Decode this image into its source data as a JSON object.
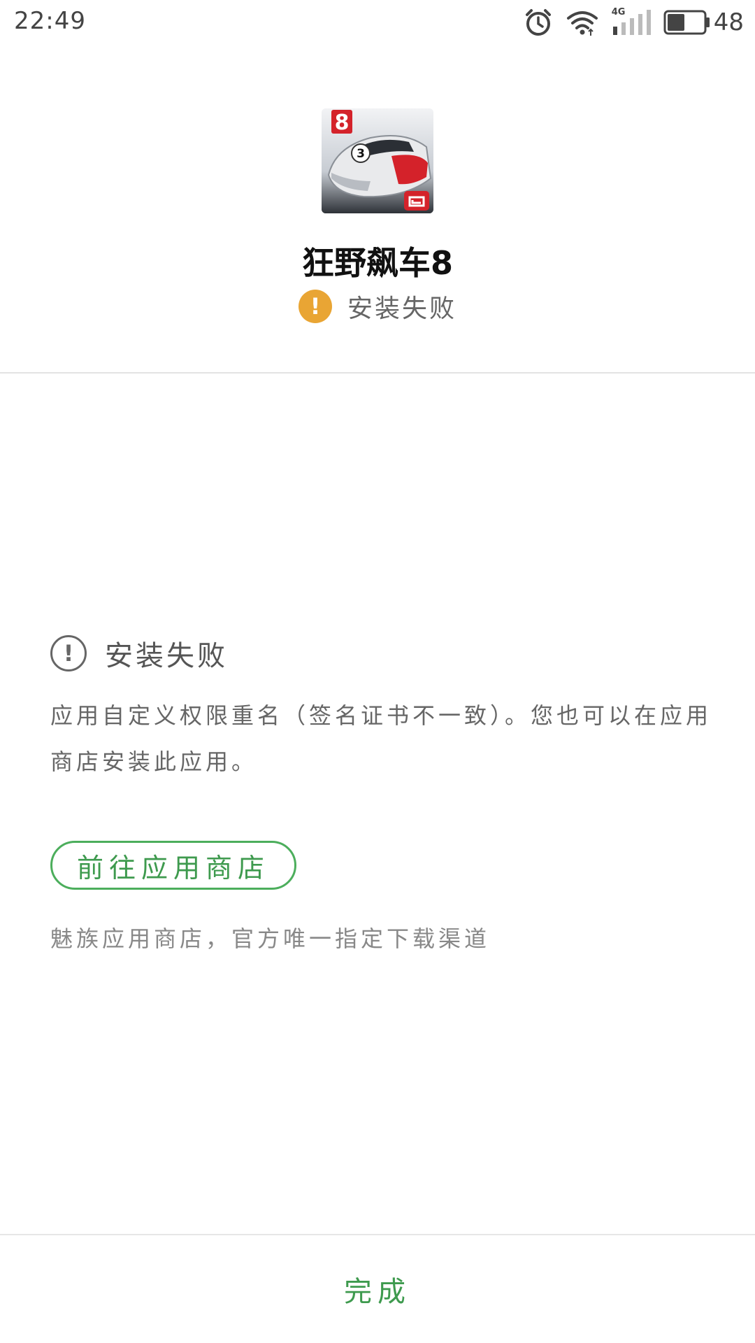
{
  "status_bar": {
    "time": "22:49",
    "network_label": "4G",
    "battery_percent": "48",
    "battery_level": 0.48,
    "icons": [
      "alarm-icon",
      "wifi-icon",
      "signal-icon",
      "battery-icon"
    ]
  },
  "app": {
    "icon": "asphalt-8-app-icon",
    "icon_badge": "8",
    "name": "狂野飙车8",
    "status": "安装失败",
    "status_icon": "warning-icon",
    "status_color": "#e9a534"
  },
  "error": {
    "icon": "info-exclamation-icon",
    "title": "安装失败",
    "message": "应用自定义权限重名（签名证书不一致）。您也可以在应用商店安装此应用。"
  },
  "store": {
    "button_label": "前往应用商店",
    "note": "魅族应用商店，官方唯一指定下载渠道",
    "accent_color": "#3e9a4e"
  },
  "footer": {
    "done_label": "完成"
  }
}
